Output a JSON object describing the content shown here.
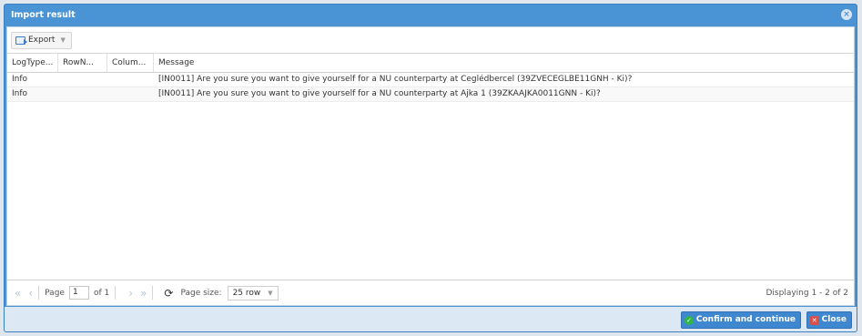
{
  "window": {
    "title": "Import result"
  },
  "toolbar": {
    "export_label": "Export"
  },
  "grid": {
    "columns": [
      "LogType...",
      "RowN...",
      "Colum...",
      "Message"
    ],
    "rows": [
      {
        "logtype": "Info",
        "rownum": "",
        "column": "",
        "message": "[IN0011] Are you sure you want to give yourself for a NU counterparty at Ceglédbercel (39ZVECEGLBE11GNH - Ki)?"
      },
      {
        "logtype": "Info",
        "rownum": "",
        "column": "",
        "message": "[IN0011] Are you sure you want to give yourself for a NU counterparty at Ajka 1 (39ZKAAJKA0011GNN - Ki)?"
      }
    ]
  },
  "pager": {
    "page_label": "Page",
    "page_value": "1",
    "of_label": "of 1",
    "page_size_label": "Page size:",
    "page_size_value": "25 row",
    "displaying": "Displaying 1 - 2 of 2"
  },
  "footer": {
    "confirm_label": "Confirm and continue",
    "close_label": "Close"
  }
}
